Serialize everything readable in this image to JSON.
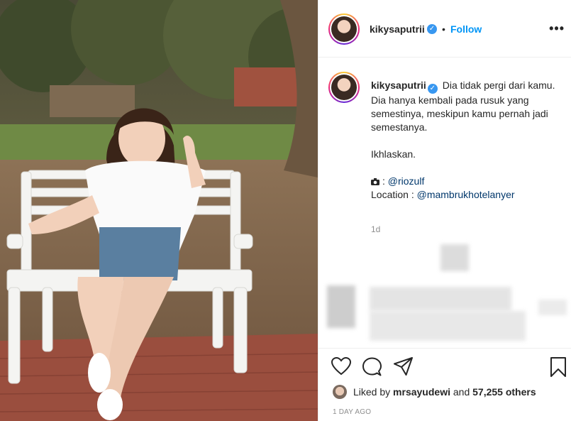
{
  "post": {
    "username": "kikysaputrii",
    "verified_mark": "✓",
    "separator": "•",
    "follow_label": "Follow",
    "more_label": "•••"
  },
  "caption": {
    "username": "kikysaputrii",
    "line1": "Dia tidak pergi dari kamu.",
    "line2": "Dia hanya kembali pada rusuk yang semestinya, meskipun kamu pernah jadi semestanya.",
    "line3": "Ikhlaskan.",
    "photo_credit": "@riozulf",
    "location_label": "Location : ",
    "location_value": "@mambrukhotelanyer",
    "time_short": "1d"
  },
  "likes": {
    "prefix": "Liked by ",
    "user": "mrsayudewi",
    "middle": " and ",
    "count_text": "57,255 others"
  },
  "time_long": "1 DAY AGO",
  "icons": [
    "heart-icon",
    "comment-icon",
    "share-icon",
    "bookmark-icon",
    "camera-icon",
    "more-icon"
  ],
  "colors": {
    "accent": "#0095f6",
    "verified": "#3897f0",
    "muted": "#8e8e8e",
    "text": "#262626"
  }
}
